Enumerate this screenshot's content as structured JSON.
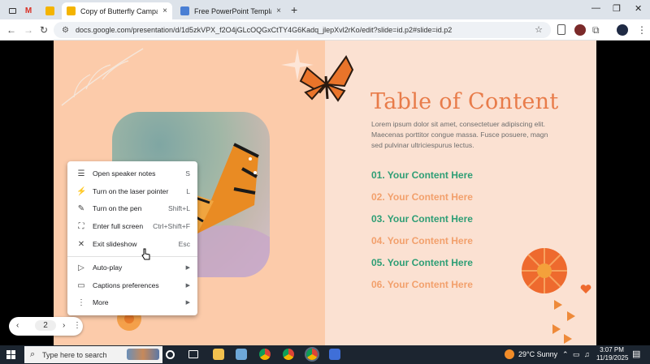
{
  "browser": {
    "tabs": [
      {
        "title": "Copy of Butterfly Campaign Ov",
        "close": "×"
      },
      {
        "title": "Free PowerPoint Templates and",
        "close": "×"
      }
    ],
    "new_tab": "+",
    "window_controls": {
      "min": "—",
      "max": "❐",
      "close": "✕"
    },
    "url": "docs.google.com/presentation/d/1d5zkVPX_f2O4jGLcOQGxCtTY4G6Kadq_jlepXvl2rKo/edit?slide=id.p2#slide=id.p2",
    "nav": {
      "back": "←",
      "forward": "→",
      "reload": "↻"
    },
    "colors": {
      "accent": "#1a73e8"
    }
  },
  "slide": {
    "title": "Table of Content",
    "body": "Lorem ipsum dolor sit amet, consectetuer adipiscing elit. Maecenas porttitor congue massa. Fusce posuere, magn sed pulvinar ultriciespurus lectus.",
    "toc": [
      {
        "label": "01. Your Content Here",
        "color": "#2e9e75"
      },
      {
        "label": "02. Your Content Here",
        "color": "#f2a06c"
      },
      {
        "label": "03. Your Content Here",
        "color": "#2e9e75"
      },
      {
        "label": "04. Your Content Here",
        "color": "#f2a06c"
      },
      {
        "label": "05. Your Content Here",
        "color": "#2e9e75"
      },
      {
        "label": "06. Your Content Here",
        "color": "#f2a06c"
      }
    ]
  },
  "context_menu": {
    "items": [
      {
        "icon": "speaker-notes-icon",
        "label": "Open speaker notes",
        "shortcut": "S"
      },
      {
        "icon": "laser-pointer-icon",
        "label": "Turn on the laser pointer",
        "shortcut": "L"
      },
      {
        "icon": "pen-icon",
        "label": "Turn on the pen",
        "shortcut": "Shift+L"
      },
      {
        "icon": "full-screen-icon",
        "label": "Enter full screen",
        "shortcut": "Ctrl+Shift+F"
      },
      {
        "icon": "close-icon",
        "label": "Exit slideshow",
        "shortcut": "Esc"
      },
      {
        "icon": "play-icon",
        "label": "Auto-play",
        "shortcut": "▶"
      },
      {
        "icon": "captions-icon",
        "label": "Captions preferences",
        "shortcut": "▶"
      },
      {
        "icon": "more-vertical-icon",
        "label": "More",
        "shortcut": "▶"
      }
    ]
  },
  "pager": {
    "prev": "‹",
    "page": "2",
    "next": "›",
    "more": "⋮"
  },
  "taskbar": {
    "search_placeholder": "Type here to search",
    "weather": "29°C  Sunny",
    "time": "3:07 PM",
    "date": "11/19/2025"
  }
}
